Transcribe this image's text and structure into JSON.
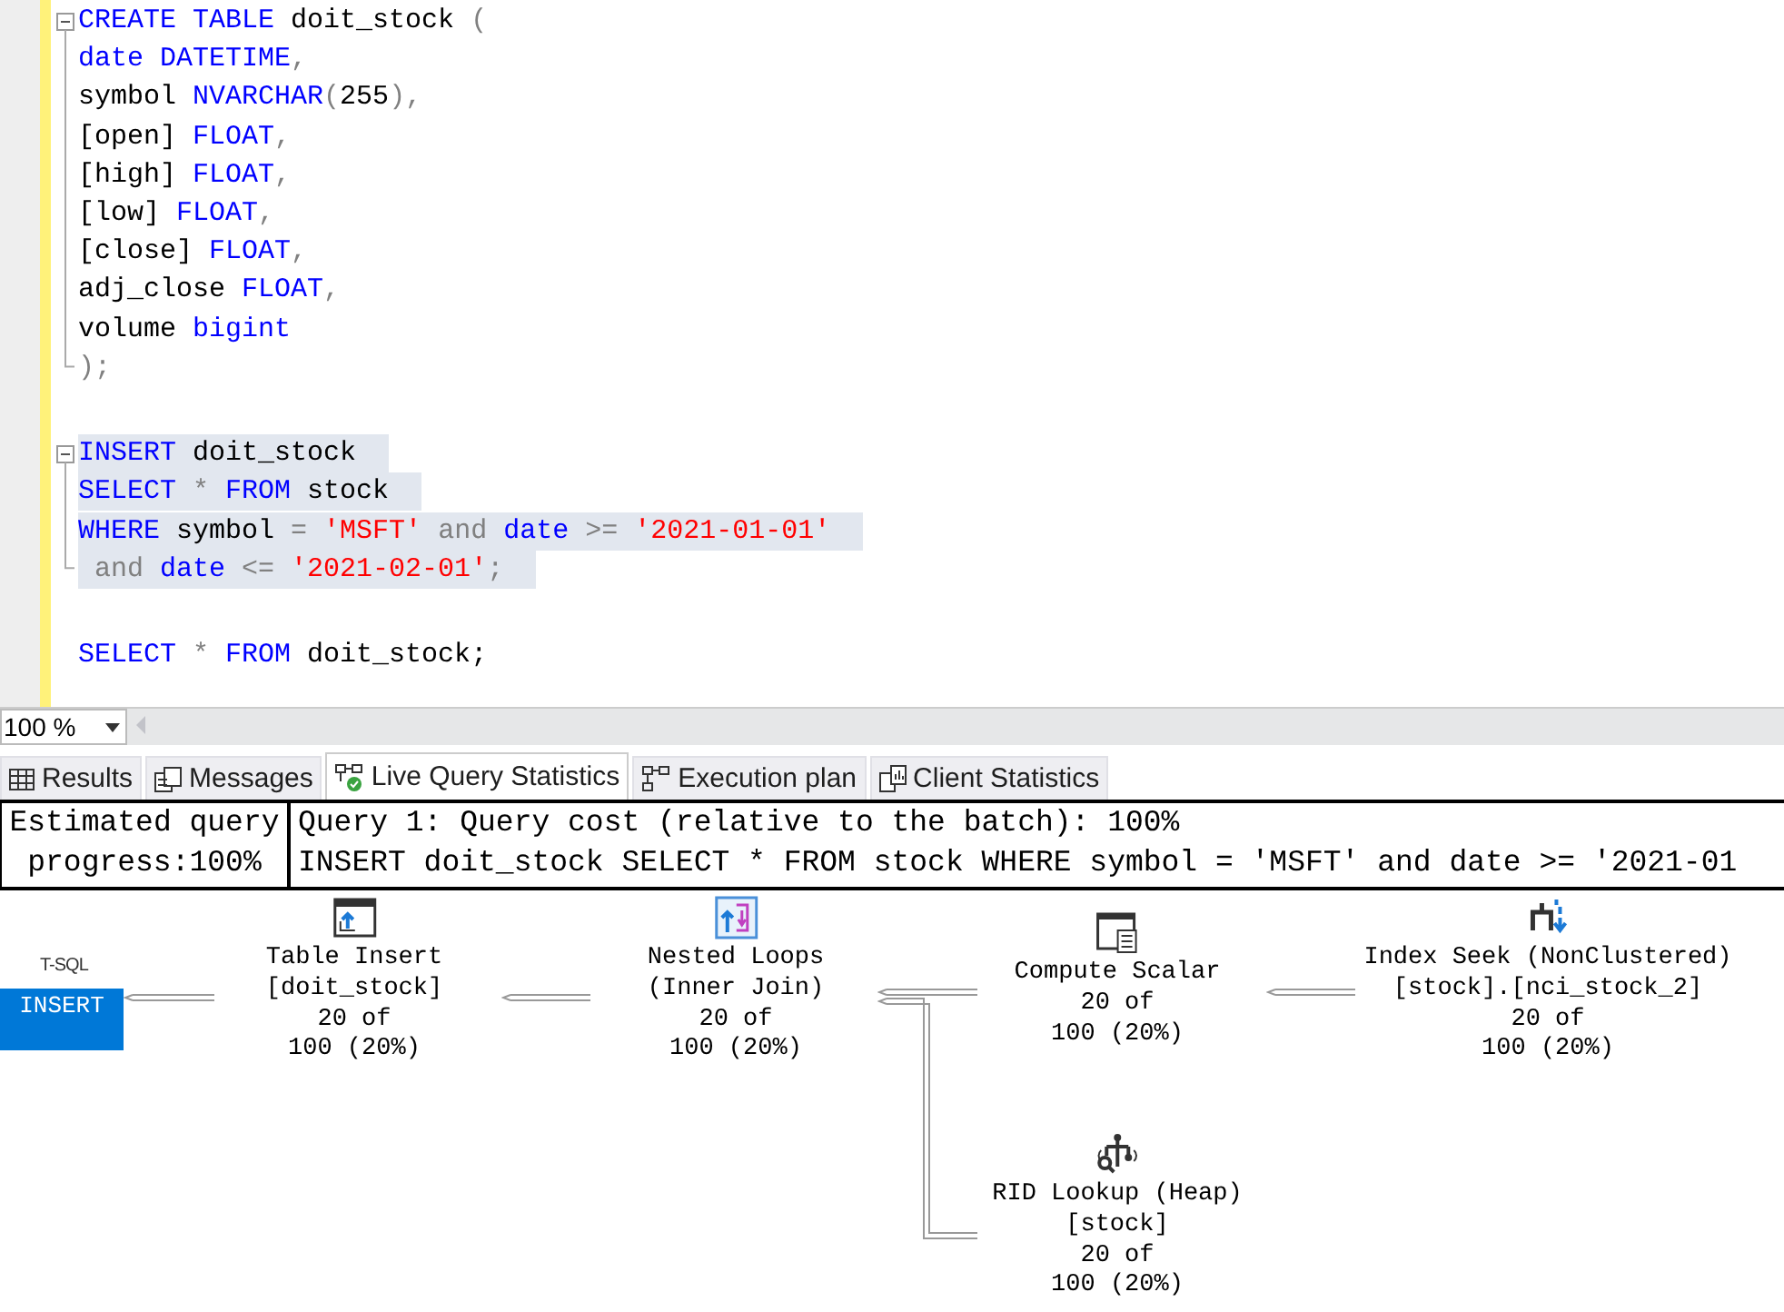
{
  "editor": {
    "statements": [
      {
        "selected": false,
        "lines": [
          [
            {
              "text": "CREATE TABLE",
              "kind": "keyword"
            },
            {
              "text": " doit_stock ",
              "kind": "name"
            },
            {
              "text": "(",
              "kind": "operator"
            }
          ],
          [
            {
              "text": "date DATETIME",
              "kind": "keyword"
            },
            {
              "text": ",",
              "kind": "operator"
            }
          ],
          [
            {
              "text": "symbol ",
              "kind": "name"
            },
            {
              "text": "NVARCHAR",
              "kind": "keyword"
            },
            {
              "text": "(",
              "kind": "operator"
            },
            {
              "text": "255",
              "kind": "name"
            },
            {
              "text": "),",
              "kind": "operator"
            }
          ],
          [
            {
              "text": "[open] ",
              "kind": "name"
            },
            {
              "text": "FLOAT",
              "kind": "keyword"
            },
            {
              "text": ",",
              "kind": "operator"
            }
          ],
          [
            {
              "text": "[high] ",
              "kind": "name"
            },
            {
              "text": "FLOAT",
              "kind": "keyword"
            },
            {
              "text": ",",
              "kind": "operator"
            }
          ],
          [
            {
              "text": "[low] ",
              "kind": "name"
            },
            {
              "text": "FLOAT",
              "kind": "keyword"
            },
            {
              "text": ",",
              "kind": "operator"
            }
          ],
          [
            {
              "text": "[close] ",
              "kind": "name"
            },
            {
              "text": "FLOAT",
              "kind": "keyword"
            },
            {
              "text": ",",
              "kind": "operator"
            }
          ],
          [
            {
              "text": "adj_close ",
              "kind": "name"
            },
            {
              "text": "FLOAT",
              "kind": "keyword"
            },
            {
              "text": ",",
              "kind": "operator"
            }
          ],
          [
            {
              "text": "volume ",
              "kind": "name"
            },
            {
              "text": "bigint",
              "kind": "keyword"
            }
          ],
          [
            {
              "text": ");",
              "kind": "operator"
            }
          ]
        ]
      },
      {
        "selected": true,
        "lines": [
          [
            {
              "text": "INSERT",
              "kind": "keyword"
            },
            {
              "text": " doit_stock",
              "kind": "name"
            }
          ],
          [
            {
              "text": "SELECT ",
              "kind": "keyword"
            },
            {
              "text": "* ",
              "kind": "operator"
            },
            {
              "text": "FROM",
              "kind": "keyword"
            },
            {
              "text": " stock",
              "kind": "name"
            }
          ],
          [
            {
              "text": "WHERE",
              "kind": "keyword"
            },
            {
              "text": " symbol ",
              "kind": "name"
            },
            {
              "text": "= ",
              "kind": "operator"
            },
            {
              "text": "'MSFT'",
              "kind": "string"
            },
            {
              "text": " and ",
              "kind": "operator"
            },
            {
              "text": "date ",
              "kind": "keyword"
            },
            {
              "text": ">= ",
              "kind": "operator"
            },
            {
              "text": "'2021-01-01'",
              "kind": "string"
            }
          ],
          [
            {
              "text": " and ",
              "kind": "operator"
            },
            {
              "text": "date ",
              "kind": "keyword"
            },
            {
              "text": "<= ",
              "kind": "operator"
            },
            {
              "text": "'2021-02-01'",
              "kind": "string"
            },
            {
              "text": ";",
              "kind": "operator"
            }
          ]
        ]
      },
      {
        "selected": false,
        "lines": [
          [
            {
              "text": "SELECT ",
              "kind": "keyword"
            },
            {
              "text": "* ",
              "kind": "operator"
            },
            {
              "text": "FROM",
              "kind": "keyword"
            },
            {
              "text": " doit_stock;",
              "kind": "name"
            }
          ]
        ]
      }
    ]
  },
  "zoom": "100 %",
  "tabs": [
    {
      "label": "Results",
      "selected": false
    },
    {
      "label": "Messages",
      "selected": false
    },
    {
      "label": "Live Query Statistics",
      "selected": true
    },
    {
      "label": "Execution plan",
      "selected": false
    },
    {
      "label": "Client Statistics",
      "selected": false
    }
  ],
  "header": {
    "progress": "Estimated query progress:100%",
    "query_title": "Query 1: Query cost (relative to the batch): 100%",
    "query_text": "INSERT doit_stock SELECT * FROM stock WHERE symbol = 'MSFT' and date >= '2021-01"
  },
  "plan": {
    "root": {
      "caption": "T-SQL",
      "label": "INSERT"
    },
    "nodes": [
      {
        "kind": "table_insert",
        "lines": [
          "Table Insert",
          "[doit_stock]",
          "20 of",
          "100 (20%)"
        ]
      },
      {
        "kind": "nested_loops",
        "lines": [
          "Nested Loops",
          "(Inner Join)",
          "20 of",
          "100 (20%)"
        ]
      },
      {
        "kind": "compute_scalar",
        "lines": [
          "Compute Scalar",
          "20 of",
          "100 (20%)"
        ]
      },
      {
        "kind": "index_seek",
        "lines": [
          "Index Seek (NonClustered)",
          "[stock].[nci_stock_2]",
          "20 of",
          "100 (20%)"
        ]
      },
      {
        "kind": "rid_lookup",
        "lines": [
          "RID Lookup (Heap)",
          "[stock]",
          "20 of",
          "100 (20%)"
        ]
      }
    ]
  }
}
